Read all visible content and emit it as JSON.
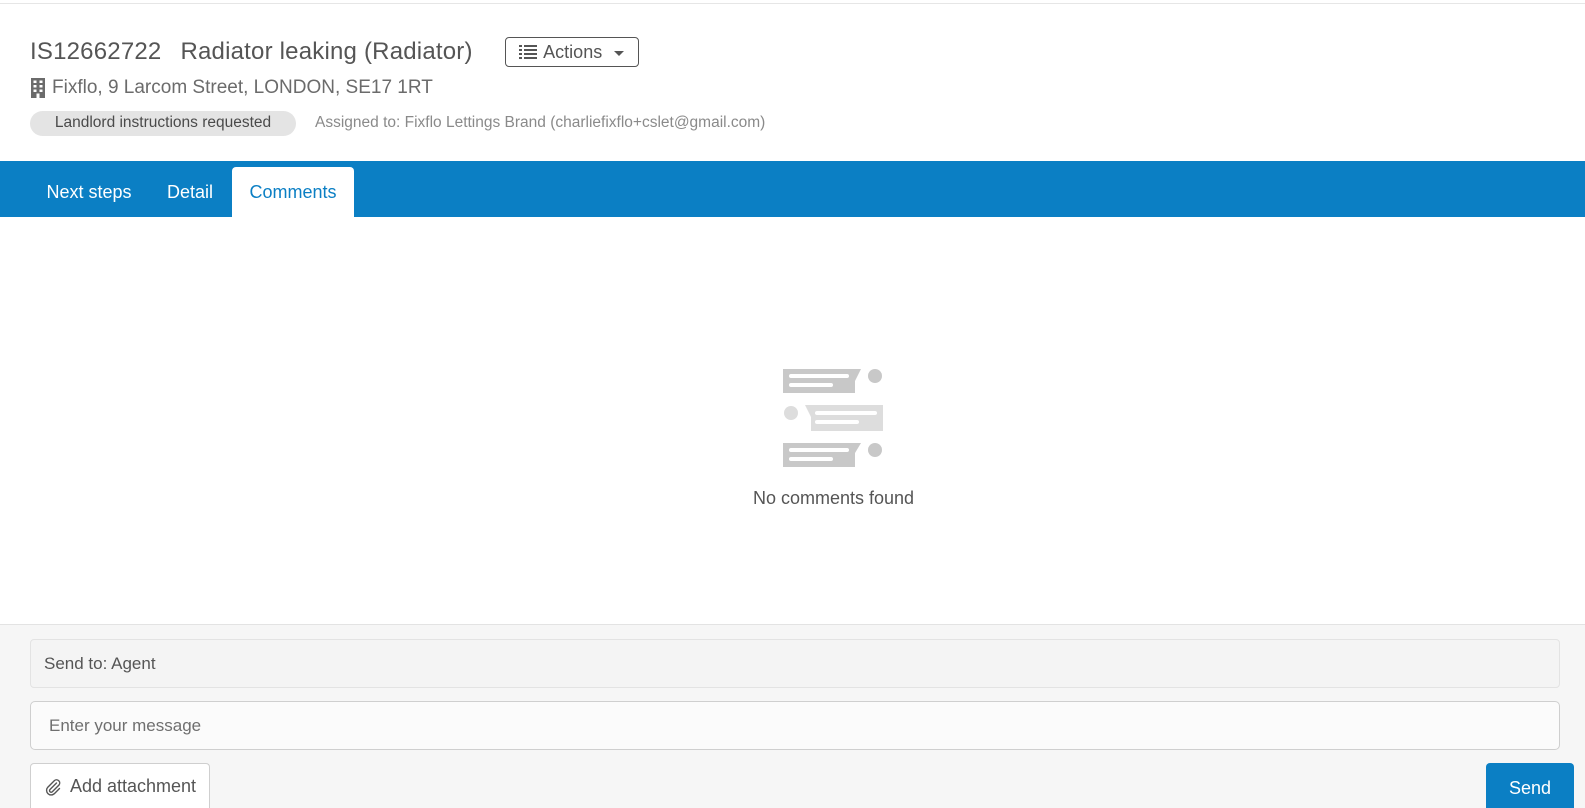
{
  "header": {
    "job_ref": "IS12662722",
    "job_title": "Radiator leaking (Radiator)",
    "actions_label": "Actions",
    "address": "Fixflo, 9 Larcom Street, LONDON, SE17 1RT",
    "status": "Landlord instructions requested",
    "assigned_to": "Assigned to: Fixflo Lettings Brand (charliefixflo+cslet@gmail.com)"
  },
  "tabs": [
    {
      "label": "Next steps",
      "active": false
    },
    {
      "label": "Detail",
      "active": false
    },
    {
      "label": "Comments",
      "active": true
    }
  ],
  "comments": {
    "empty_message": "No comments found"
  },
  "compose": {
    "send_to": "Send to: Agent",
    "message_placeholder": "Enter your message",
    "attachment_label": "Add attachment",
    "send_label": "Send"
  },
  "colors": {
    "brand_blue": "#0b7fc4",
    "text_grey": "#555555",
    "badge_bg": "#e4e4e4"
  }
}
